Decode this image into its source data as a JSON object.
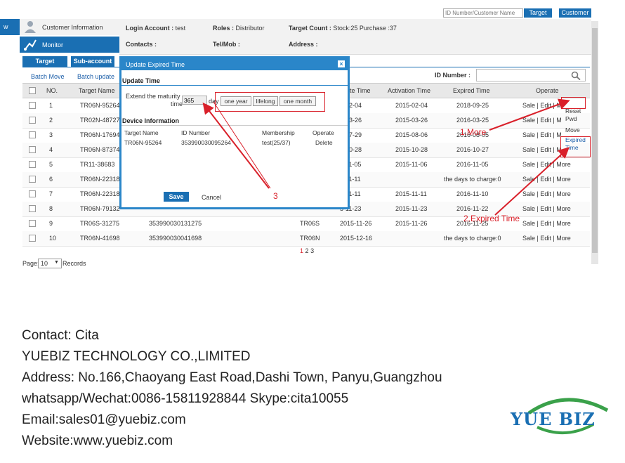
{
  "top": {
    "search_placeholder": "ID Number/Customer Name",
    "target_button": "Target",
    "customer_button": "Customer"
  },
  "nav": {
    "left_edge_text": "w",
    "customer_info": "Customer Information",
    "monitor": "Monitor"
  },
  "info": {
    "login_label": "Login Account :",
    "login_value": "test",
    "roles_label": "Roles :",
    "roles_value": "Distributor",
    "target_count_label": "Target Count :",
    "target_count_value": "Stock:25 Purchase :37",
    "contacts_label": "Contacts :",
    "telmob_label": "Tel/Mob :",
    "address_label": "Address :"
  },
  "tabs": [
    "Target",
    "Sub-account"
  ],
  "actions": {
    "batch_move": "Batch Move",
    "batch_update": "Batch update"
  },
  "id_number_label": "ID Number :",
  "table": {
    "headers": [
      "NO.",
      "Target Name",
      "te Time",
      "Activation Time",
      "Expired Time",
      "Operate"
    ],
    "rows": [
      {
        "no": "1",
        "name": "TR06N-95264",
        "id": "",
        "model": "",
        "start": "5-02-04",
        "activation": "2015-02-04",
        "expired": "2018-09-25",
        "op": "Sale | Edit | M"
      },
      {
        "no": "2",
        "name": "TR02N-48727",
        "id": "",
        "model": "",
        "start": "5-03-26",
        "activation": "2015-03-26",
        "expired": "2016-03-25",
        "op": "Sale | Edit | M"
      },
      {
        "no": "3",
        "name": "TR06N-17694",
        "id": "",
        "model": "",
        "start": "5-07-29",
        "activation": "2015-08-06",
        "expired": "2016-08-05",
        "op": "Sale | Edit | M"
      },
      {
        "no": "4",
        "name": "TR06N-87374",
        "id": "",
        "model": "",
        "start": "5-10-28",
        "activation": "2015-10-28",
        "expired": "2016-10-27",
        "op": "Sale | Edit | M"
      },
      {
        "no": "5",
        "name": "TR11-38683",
        "id": "",
        "model": "",
        "start": "5-11-05",
        "activation": "2015-11-06",
        "expired": "2016-11-05",
        "op": "Sale | Edit | More"
      },
      {
        "no": "6",
        "name": "TR06N-22318",
        "id": "",
        "model": "",
        "start": "5-11-11",
        "activation": "",
        "expired": "the days to charge:0",
        "op": "Sale | Edit | More"
      },
      {
        "no": "7",
        "name": "TR06N-22318",
        "id": "",
        "model": "",
        "start": "5-11-11",
        "activation": "2015-11-11",
        "expired": "2016-11-10",
        "op": "Sale | Edit | More"
      },
      {
        "no": "8",
        "name": "TR06N-79132",
        "id": "",
        "model": "",
        "start": "5-11-23",
        "activation": "2015-11-23",
        "expired": "2016-11-22",
        "op": "Sale | Edit | More"
      },
      {
        "no": "9",
        "name": "TR06S-31275",
        "id": "353990030131275",
        "model": "TR06S",
        "start": "2015-11-26",
        "activation": "2015-11-26",
        "expired": "2016-11-25",
        "op": "Sale | Edit | More"
      },
      {
        "no": "10",
        "name": "TR06N-41698",
        "id": "353990030041698",
        "model": "TR06N",
        "start": "2015-12-16",
        "activation": "",
        "expired": "the days to charge:0",
        "op": "Sale | Edit | More"
      }
    ]
  },
  "pagination": {
    "current": "1",
    "p2": "2",
    "p3": "3"
  },
  "pagesize": {
    "label": "Page:",
    "value": "10",
    "suffix": "Records"
  },
  "more_menu": [
    "Reset Pwd",
    "Move",
    "Expired Time"
  ],
  "dialog": {
    "title": "Update Expired Time",
    "section1": "Update Time",
    "extend_label_1": "Extend the maturity",
    "extend_label_2": "time",
    "days_value": "365",
    "day_unit": "day",
    "btn_year": "one year",
    "btn_lifelong": "lifelong",
    "btn_month": "one month",
    "section2": "Device Information",
    "dev_headers": [
      "Target Name",
      "ID Number",
      "Membership",
      "Operate"
    ],
    "dev_row": [
      "TR06N-95264",
      "353990030095264",
      "test(25/37)",
      "Delete"
    ],
    "save": "Save",
    "cancel": "Cancel"
  },
  "annotations": {
    "a1": "1.More",
    "a2": "2.Expired Time",
    "a3": "3"
  },
  "footer": {
    "contact": "Contact: Cita",
    "company": "YUEBIZ TECHNOLOGY CO.,LIMITED",
    "address": "Address: No.166,Chaoyang East Road,Dashi Town, Panyu,Guangzhou",
    "whatsapp": "whatsapp/Wechat:0086-15811928844  Skype:cita10055",
    "email": "Email:sales01@yuebiz.com",
    "website": "Website:www.yuebiz.com"
  },
  "logo": {
    "text": "YUE BIZ",
    "colors": {
      "blue": "#1a6fb3",
      "green": "#3aa14a"
    }
  },
  "colors": {
    "accent": "#1a6fb3",
    "annotation": "#d9202a",
    "dialog_border": "#2a86c9"
  }
}
